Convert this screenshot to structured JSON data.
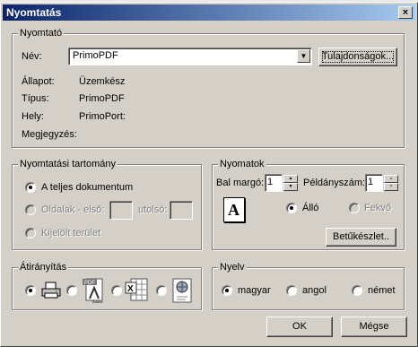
{
  "dialog": {
    "title": "Nyomtatás",
    "close_glyph": "×"
  },
  "printer": {
    "legend": "Nyomtató",
    "name_label": "Név:",
    "name_value": "PrimoPDF",
    "properties_button": "Tulajdonságok...",
    "status_label": "Állapot:",
    "status_value": "Üzemkész",
    "type_label": "Típus:",
    "type_value": "PrimoPDF",
    "location_label": "Hely:",
    "location_value": "PrimoPort:",
    "comment_label": "Megjegyzés:",
    "comment_value": ""
  },
  "range": {
    "legend": "Nyomtatási tartomány",
    "whole_doc": "A teljes dokumentum",
    "pages": "Oldalak - első:",
    "last": "utolsó:",
    "selection": "Kijelölt terület"
  },
  "prints": {
    "legend": "Nyomatok",
    "left_margin_label": "Bal margó:",
    "left_margin_value": "1",
    "copies_label": "Példányszám:",
    "copies_value": "1",
    "orientation_icon_letter": "A",
    "portrait": "Álló",
    "landscape": "Fekvő",
    "font_button": "Betűkészlet.."
  },
  "redirect": {
    "legend": "Átirányítás",
    "options": [
      {
        "icon": "printer-icon",
        "selected": true
      },
      {
        "icon": "pdf-icon",
        "icon_text": "PDF",
        "icon_subtext": "Adobe",
        "selected": false
      },
      {
        "icon": "excel-icon",
        "icon_text": "X",
        "selected": false
      },
      {
        "icon": "web-page-icon",
        "selected": false
      }
    ]
  },
  "language": {
    "legend": "Nyelv",
    "options": [
      "magyar",
      "angol",
      "német"
    ],
    "selected": "magyar"
  },
  "buttons": {
    "ok": "OK",
    "cancel": "Mégse"
  },
  "colors": {
    "title_start": "#0a246a",
    "title_end": "#a6caf0",
    "face": "#d4d0c8"
  }
}
